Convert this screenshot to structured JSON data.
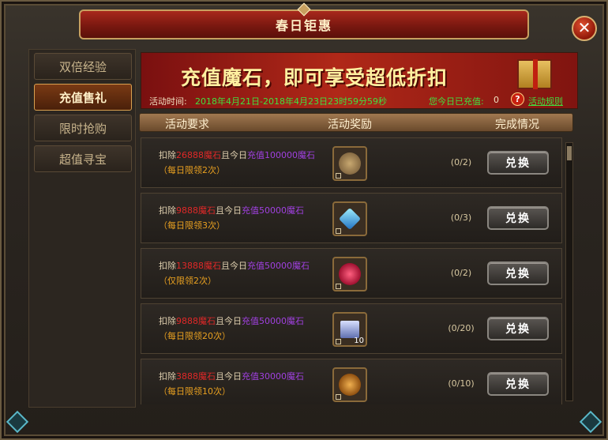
{
  "window": {
    "title": "春日钜惠",
    "close_label": "✕"
  },
  "nav": {
    "items": [
      {
        "label": "双倍经验",
        "active": false
      },
      {
        "label": "充值售礼",
        "active": true
      },
      {
        "label": "限时抢购",
        "active": false
      },
      {
        "label": "超值寻宝",
        "active": false
      }
    ]
  },
  "banner": {
    "slogan": "充值魔石，即可享受超低折扣",
    "time_label": "活动时间:",
    "time_value": "2018年4月21日-2018年4月23日23时59分59秒",
    "recharged_label": "您今日已充值:",
    "recharged_value": "0",
    "help_icon": "?",
    "rules_label": "活动规则"
  },
  "table": {
    "headers": {
      "requirement": "活动要求",
      "reward": "活动奖励",
      "status": "完成情况"
    },
    "exchange_label": "兑换",
    "rows": [
      {
        "req_prefix": "扣除",
        "deduct": "26888魔石",
        "req_mid": "且今日",
        "recharge": "充值100000魔石",
        "limit": "（每日限领2次）",
        "progress": "(0/2)",
        "reward_icon": "medal-icon",
        "reward_count": ""
      },
      {
        "req_prefix": "扣除",
        "deduct": "9888魔石",
        "req_mid": "且今日",
        "recharge": "充值50000魔石",
        "limit": "（每日限领3次）",
        "progress": "(0/3)",
        "reward_icon": "crystal-icon",
        "reward_count": ""
      },
      {
        "req_prefix": "扣除",
        "deduct": "13888魔石",
        "req_mid": "且今日",
        "recharge": "充值50000魔石",
        "limit": "（仅限领2次）",
        "progress": "(0/2)",
        "reward_icon": "orb-icon",
        "reward_count": ""
      },
      {
        "req_prefix": "扣除",
        "deduct": "9888魔石",
        "req_mid": "且今日",
        "recharge": "充值50000魔石",
        "limit": "（每日限领20次）",
        "progress": "(0/20)",
        "reward_icon": "gift-box-icon",
        "reward_count": "10"
      },
      {
        "req_prefix": "扣除",
        "deduct": "3888魔石",
        "req_mid": "且今日",
        "recharge": "充值30000魔石",
        "limit": "（每日限领10次）",
        "progress": "(0/10)",
        "reward_icon": "coin-icon",
        "reward_count": ""
      }
    ]
  },
  "colors": {
    "deduct": "#e02828",
    "recharge": "#a040e0",
    "limit": "#e8a020",
    "time": "#40e040"
  }
}
